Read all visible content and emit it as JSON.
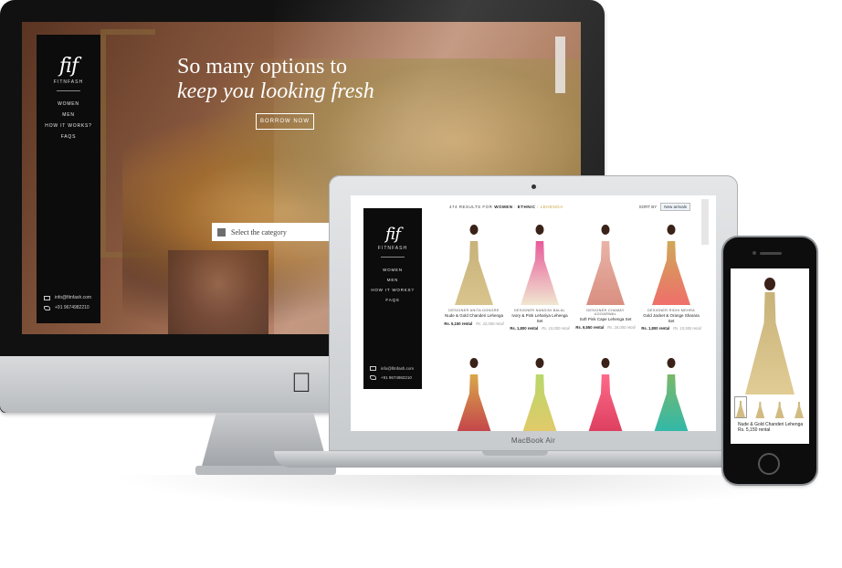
{
  "brand": {
    "logo_mark": "fif",
    "logo_word": "FITNFASH"
  },
  "desktop": {
    "nav": [
      "WOMEN",
      "MEN",
      "HOW IT WORKS?",
      "FAQS"
    ],
    "contact_email": "info@fitnfash.com",
    "contact_phone": "+91 9674982210",
    "headline_line1": "So many options to",
    "headline_line2": "keep you looking fresh",
    "cta": "BORROW NOW",
    "category_placeholder": "Select the category"
  },
  "laptop": {
    "results_count": "474 RESULTS FOR",
    "results_women": "WOMEN",
    "results_sep1": " : ",
    "results_ethnic": "ETHNIC",
    "results_sep2": " : ",
    "results_lehenga": "LEHENGA",
    "sort_label": "SORT BY",
    "sort_value": "New arrivals",
    "label": "MacBook Air",
    "products": [
      {
        "designer": "DESIGNER ANITA DONGRE",
        "name": "Nude & Gold Chanderi Lehenga",
        "price": "Rs. 5,150 rental",
        "retail": "Rs. 32,000 retail"
      },
      {
        "designer": "DESIGNER NANDINI BALAL",
        "name": "Ivory & Pink Lehariya Lehenga Set",
        "price": "Rs. 1,800 rental",
        "retail": "Rs. 10,000 retail"
      },
      {
        "designer": "DESIGNER CHAMAY AGGARWAL",
        "name": "Soft Pink Cape Lehenga Set",
        "price": "Rs. 6,550 rental",
        "retail": "Rs. 28,000 retail"
      },
      {
        "designer": "DESIGNER RIDHI MEHRA",
        "name": "Gold Jacket & Orange Sharara Set",
        "price": "Rs. 1,800 rental",
        "retail": "Rs. 10,500 retail"
      }
    ]
  },
  "phone": {
    "product_name": "Nude & Gold Chanderi Lehenga",
    "price": "Rs. 5,150 rental"
  },
  "colors": {
    "gold_accent": "#c9a03a",
    "sidebar": "#0c0c0c"
  },
  "icons": [
    "apple-icon",
    "mail-icon",
    "phone-icon"
  ]
}
